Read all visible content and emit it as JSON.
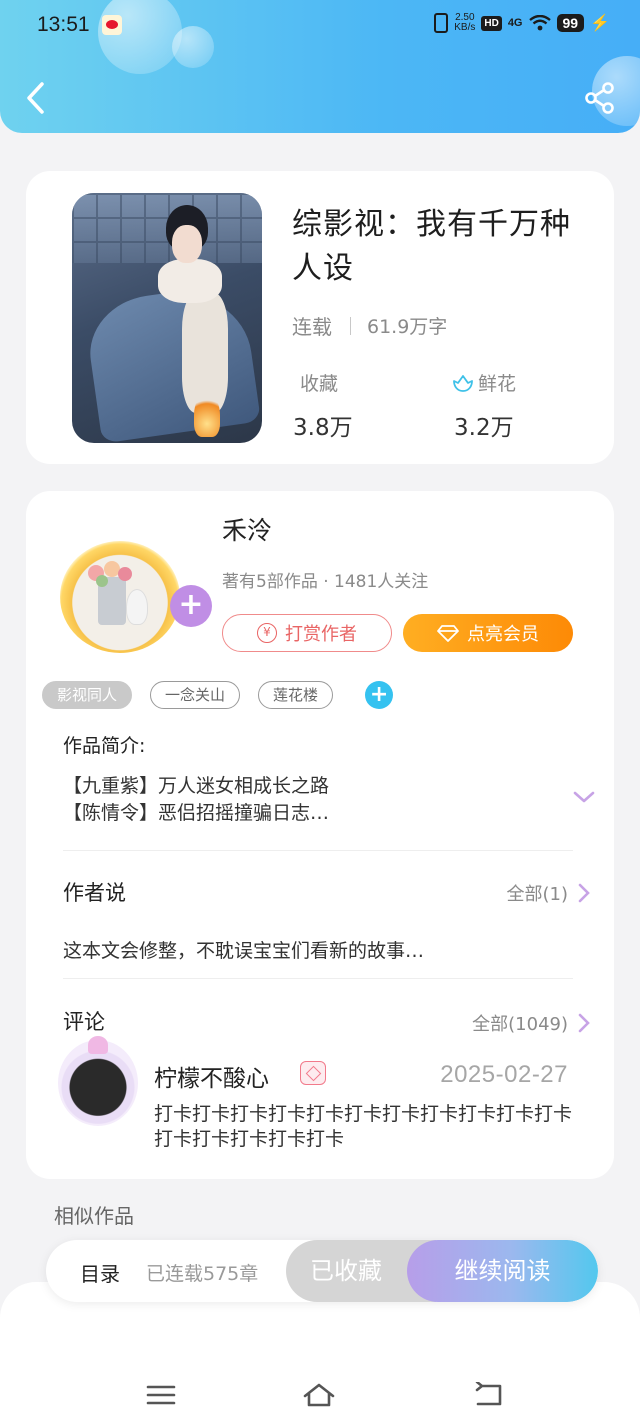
{
  "status_bar": {
    "time": "13:51",
    "net_speed_value": "2.50",
    "net_speed_unit": "KB/s",
    "hd": "HD",
    "signal": "4G",
    "battery": "99"
  },
  "book": {
    "title": "综影视：我有千万种人设",
    "status": "连载",
    "word_count": "61.9万字",
    "favorites_label": "收藏",
    "favorites_value": "3.8万",
    "flowers_label": "鲜花",
    "flowers_value": "3.2万"
  },
  "author": {
    "name": "禾泠",
    "meta": "著有5部作品 · 1481人关注",
    "reward_label": "打赏作者",
    "vip_label": "点亮会员",
    "reward_color": "#e96565",
    "vip_color": "#fd8a06"
  },
  "tags": [
    {
      "label": "影视同人"
    },
    {
      "label": "一念关山"
    },
    {
      "label": "莲花楼"
    }
  ],
  "intro": {
    "title": "作品简介:",
    "line1": "【九重紫】万人迷女相成长之路",
    "line2": "【陈情令】恶侣招摇撞骗日志…"
  },
  "author_says": {
    "title": "作者说",
    "more": "全部(1)",
    "text": "这本文会修整，不耽误宝宝们看新的故事…"
  },
  "comments": {
    "title": "评论",
    "more": "全部(1049)",
    "item": {
      "user": "柠檬不酸心",
      "date": "2025-02-27",
      "text": "打卡打卡打卡打卡打卡打卡打卡打卡打卡打卡打卡打卡打卡打卡打卡打卡"
    }
  },
  "similar_title": "相似作品",
  "bottom_bar": {
    "toc": "目录",
    "chapters": "已连载575章",
    "saved": "已收藏",
    "read": "继续阅读"
  },
  "icons": {
    "back": "chevron-left-icon",
    "share": "share-icon",
    "flower": "flower-icon",
    "nav_menu": "menu-icon",
    "nav_home": "home-icon",
    "nav_back": "back-icon"
  },
  "colors": {
    "header_accent": "#4cb7f5",
    "tag_add": "#35c2f0",
    "follow_plus": "#c08ee5"
  }
}
